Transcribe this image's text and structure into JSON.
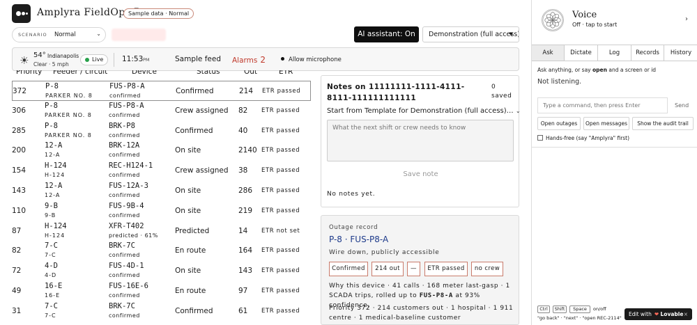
{
  "header": {
    "app_title": "Amplyra FieldOps Pro",
    "sample_badge": "Sample data · Normal"
  },
  "scenario": {
    "label": "SCENARIO",
    "value": "Normal"
  },
  "ai_button": "AI assistant: On",
  "demo_select": "Demonstration (full access)",
  "statusbar": {
    "temp": "54°",
    "city": "Indianapolis",
    "weather": "Clear · 5 mph",
    "live": "Live",
    "time": "11:53",
    "ampm": "PM",
    "feed": "Sample feed",
    "alarms_label": "Alarms",
    "alarms_count": "2",
    "mic": "Allow microphone"
  },
  "table": {
    "headers": {
      "priority": "Priority",
      "feeder": "Feeder / circuit",
      "device": "Device",
      "status": "Status",
      "out": "Out",
      "etr": "ETR"
    },
    "rows": [
      {
        "priority": "372",
        "feeder": "P-8",
        "feeder_sub": "PARKER NO. 8",
        "device": "FUS-P8-A",
        "device_sub": "confirmed",
        "status": "Confirmed",
        "out": "214",
        "etr": "ETR passed"
      },
      {
        "priority": "306",
        "feeder": "P-8",
        "feeder_sub": "PARKER NO. 8",
        "device": "FUS-P8-A",
        "device_sub": "confirmed",
        "status": "Crew assigned",
        "out": "82",
        "etr": "ETR passed"
      },
      {
        "priority": "285",
        "feeder": "P-8",
        "feeder_sub": "PARKER NO. 8",
        "device": "BRK-P8",
        "device_sub": "confirmed",
        "status": "Confirmed",
        "out": "40",
        "etr": "ETR passed"
      },
      {
        "priority": "200",
        "feeder": "12-A",
        "feeder_sub": "12-A",
        "device": "BRK-12A",
        "device_sub": "confirmed",
        "status": "On site",
        "out": "2140",
        "etr": "ETR passed"
      },
      {
        "priority": "154",
        "feeder": "H-124",
        "feeder_sub": "H-124",
        "device": "REC-H124-1",
        "device_sub": "confirmed",
        "status": "Crew assigned",
        "out": "38",
        "etr": "ETR passed"
      },
      {
        "priority": "143",
        "feeder": "12-A",
        "feeder_sub": "12-A",
        "device": "FUS-12A-3",
        "device_sub": "confirmed",
        "status": "On site",
        "out": "286",
        "etr": "ETR passed"
      },
      {
        "priority": "110",
        "feeder": "9-B",
        "feeder_sub": "9-B",
        "device": "FUS-9B-4",
        "device_sub": "confirmed",
        "status": "On site",
        "out": "219",
        "etr": "ETR passed"
      },
      {
        "priority": "87",
        "feeder": "H-124",
        "feeder_sub": "H-124",
        "device": "XFR-T402",
        "device_sub": "predicted · 61%",
        "status": "Predicted",
        "out": "14",
        "etr": "ETR not set"
      },
      {
        "priority": "82",
        "feeder": "7-C",
        "feeder_sub": "7-C",
        "device": "BRK-7C",
        "device_sub": "confirmed",
        "status": "En route",
        "out": "164",
        "etr": "ETR passed"
      },
      {
        "priority": "72",
        "feeder": "4-D",
        "feeder_sub": "4-D",
        "device": "FUS-4D-1",
        "device_sub": "confirmed",
        "status": "On site",
        "out": "143",
        "etr": "ETR passed"
      },
      {
        "priority": "49",
        "feeder": "16-E",
        "feeder_sub": "16-E",
        "device": "FUS-16E-6",
        "device_sub": "confirmed",
        "status": "En route",
        "out": "97",
        "etr": "ETR passed"
      },
      {
        "priority": "31",
        "feeder": "7-C",
        "feeder_sub": "7-C",
        "device": "BRK-7C",
        "device_sub": "confirmed",
        "status": "Confirmed",
        "out": "61",
        "etr": "ETR passed"
      }
    ]
  },
  "notes": {
    "title": "Notes on 11111111-1111-4111-8111-111111111111",
    "saved_count": "0",
    "saved_label": "saved",
    "template": "Start from Template for Demonstration (full access)…",
    "placeholder": "What the next shift or crew needs to know",
    "save_button": "Save note",
    "empty": "No notes yet."
  },
  "outage": {
    "heading": "Outage record",
    "title": "P-8 · FUS-P8-A",
    "subtitle": "Wire down, publicly accessible",
    "chips": [
      "Confirmed",
      "214 out",
      "—",
      "ETR passed",
      "no crew"
    ],
    "why_prefix": "Why this device · 41 calls · 168 meter last-gasp · 1 SCADA trips, rolled up to",
    "why_device": "FUS-P8-A",
    "why_suffix": "at 93% confidence.",
    "priority_line": "Priority 372 · 214 customers out · 1 hospital · 1 911 centre · 1 medical-baseline customer"
  },
  "voice": {
    "title": "Voice",
    "subtitle": "Off · tap to start",
    "tabs": [
      "Ask",
      "Dictate",
      "Log",
      "Records",
      "History"
    ],
    "hint_prefix": "Ask anything, or say",
    "hint_word": "open",
    "hint_suffix": "and a screen or id",
    "listening": "Not listening.",
    "command_placeholder": "Type a command, then press Enter",
    "send": "Send",
    "quick": [
      "Open outages",
      "Open messages",
      "Show the audit trail"
    ],
    "handsfree": "Hands-free (say \"Amplyra\" first)",
    "keys": [
      "Ctrl",
      "Shift",
      "Space"
    ],
    "onoff": "on/off",
    "keyhelp": "\"go back\" · \"next\" · \"open REC-2114\""
  },
  "lovable": {
    "label": "Edit with",
    "brand": "Lovable"
  },
  "colors": {
    "accent_red": "#c0392b",
    "link_blue": "#1d3a8a",
    "chip_border": "#c97b6b",
    "live_green": "#27a04a"
  }
}
